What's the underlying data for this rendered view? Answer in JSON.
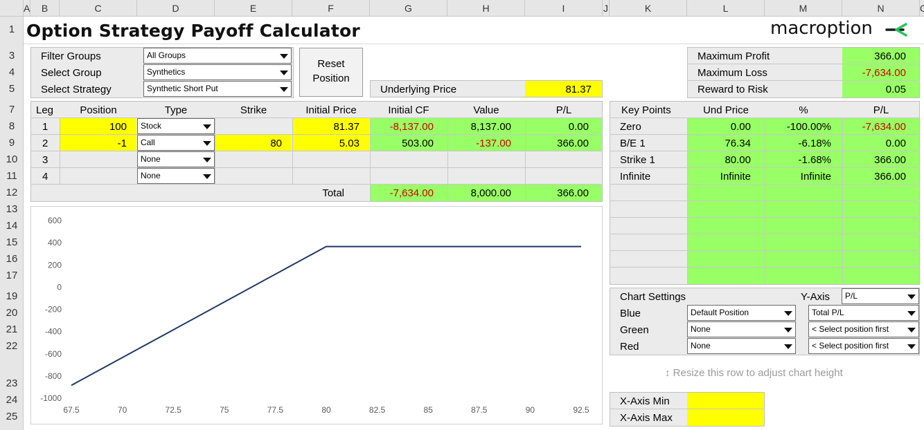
{
  "columns": [
    "A",
    "B",
    "C",
    "D",
    "E",
    "F",
    "G",
    "H",
    "I",
    "J",
    "K",
    "L",
    "M",
    "N",
    "O"
  ],
  "rows": [
    "1",
    "3",
    "4",
    "5",
    "7",
    "8",
    "9",
    "10",
    "11",
    "12",
    "13",
    "14",
    "15",
    "16",
    "17",
    "19",
    "20",
    "21",
    "22",
    "23",
    "24",
    "25"
  ],
  "title": "Option Strategy Payoff Calculator",
  "logo": "macroption",
  "filters": {
    "filter_groups_label": "Filter Groups",
    "filter_groups_value": "All Groups",
    "select_group_label": "Select Group",
    "select_group_value": "Synthetics",
    "select_strategy_label": "Select Strategy",
    "select_strategy_value": "Synthetic Short Put",
    "reset_label_1": "Reset",
    "reset_label_2": "Position"
  },
  "underlying": {
    "label": "Underlying Price",
    "value": "81.37"
  },
  "summary": {
    "max_profit_label": "Maximum Profit",
    "max_profit": "366.00",
    "max_loss_label": "Maximum Loss",
    "max_loss": "-7,634.00",
    "rr_label": "Reward to Risk",
    "rr": "0.05"
  },
  "legs_table": {
    "headers": [
      "Leg",
      "Position",
      "Type",
      "Strike",
      "Initial Price",
      "Initial CF",
      "Value",
      "P/L"
    ],
    "rows": [
      {
        "leg": "1",
        "position": "100",
        "type": "Stock",
        "strike": "",
        "price": "81.37",
        "cf": "-8,137.00",
        "value": "8,137.00",
        "pl": "0.00"
      },
      {
        "leg": "2",
        "position": "-1",
        "type": "Call",
        "strike": "80",
        "price": "5.03",
        "cf": "503.00",
        "value": "-137.00",
        "pl": "366.00"
      },
      {
        "leg": "3",
        "position": "",
        "type": "None",
        "strike": "",
        "price": "",
        "cf": "",
        "value": "",
        "pl": ""
      },
      {
        "leg": "4",
        "position": "",
        "type": "None",
        "strike": "",
        "price": "",
        "cf": "",
        "value": "",
        "pl": ""
      }
    ],
    "total_label": "Total",
    "total_cf": "-7,634.00",
    "total_value": "8,000.00",
    "total_pl": "366.00"
  },
  "key_points": {
    "headers": [
      "Key Points",
      "Und Price",
      "%",
      "P/L"
    ],
    "rows": [
      {
        "name": "Zero",
        "price": "0.00",
        "pct": "-100.00%",
        "pl": "-7,634.00"
      },
      {
        "name": "B/E 1",
        "price": "76.34",
        "pct": "-6.18%",
        "pl": "0.00"
      },
      {
        "name": "Strike 1",
        "price": "80.00",
        "pct": "-1.68%",
        "pl": "366.00"
      },
      {
        "name": "Infinite",
        "price": "Infinite",
        "pct": "Infinite",
        "pl": "366.00"
      }
    ]
  },
  "chart_settings": {
    "label": "Chart Settings",
    "y_axis_label": "Y-Axis",
    "y_axis_value": "P/L",
    "blue_label": "Blue",
    "blue_pos": "Default Position",
    "blue_metric": "Total P/L",
    "green_label": "Green",
    "green_pos": "None",
    "green_metric": "< Select position first",
    "red_label": "Red",
    "red_pos": "None",
    "red_metric": "< Select position first"
  },
  "resize_hint": "↕ Resize this row to adjust chart height",
  "xaxis": {
    "min_label": "X-Axis Min",
    "max_label": "X-Axis Max"
  },
  "colors": {
    "line": "#1f3864",
    "yellow": "#ffff00",
    "green": "#99ff66",
    "loss": "#cc0000"
  },
  "chart_data": {
    "type": "line",
    "x": [
      67.5,
      70,
      72.5,
      75,
      77.5,
      80,
      82.5,
      85,
      87.5,
      90,
      92.5
    ],
    "series": [
      {
        "values": [
          -884,
          -634,
          -384,
          -134,
          116,
          366,
          366,
          366,
          366,
          366,
          366
        ]
      }
    ],
    "xticks": [
      "67.5",
      "70",
      "72.5",
      "75",
      "77.5",
      "80",
      "82.5",
      "85",
      "87.5",
      "90",
      "92.5"
    ],
    "yticks": [
      "600",
      "400",
      "200",
      "0",
      "-200",
      "-400",
      "-600",
      "-800",
      "-1000"
    ],
    "xlim": [
      67.5,
      92.5
    ],
    "ylim": [
      -1000,
      600
    ],
    "grid": false
  }
}
